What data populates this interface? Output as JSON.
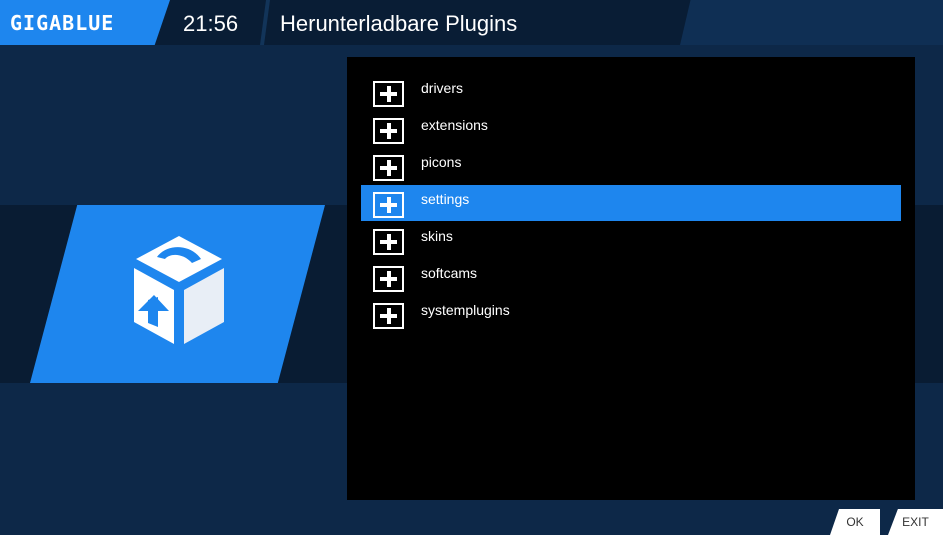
{
  "brand": {
    "logo": "GIGABLUE"
  },
  "header": {
    "clock": "21:56",
    "title": "Herunterladbare Plugins"
  },
  "plugin_categories": [
    {
      "label": "drivers",
      "selected": false
    },
    {
      "label": "extensions",
      "selected": false
    },
    {
      "label": "picons",
      "selected": false
    },
    {
      "label": "settings",
      "selected": true
    },
    {
      "label": "skins",
      "selected": false
    },
    {
      "label": "softcams",
      "selected": false
    },
    {
      "label": "systemplugins",
      "selected": false
    }
  ],
  "footer": {
    "ok_label": "OK",
    "exit_label": "EXIT"
  },
  "icons": {
    "plugin": "plugin-cube-icon",
    "category": "plus-box-icon"
  },
  "colors": {
    "accent": "#1e86ee",
    "background": "#0d2848",
    "list_bg": "#000000"
  }
}
